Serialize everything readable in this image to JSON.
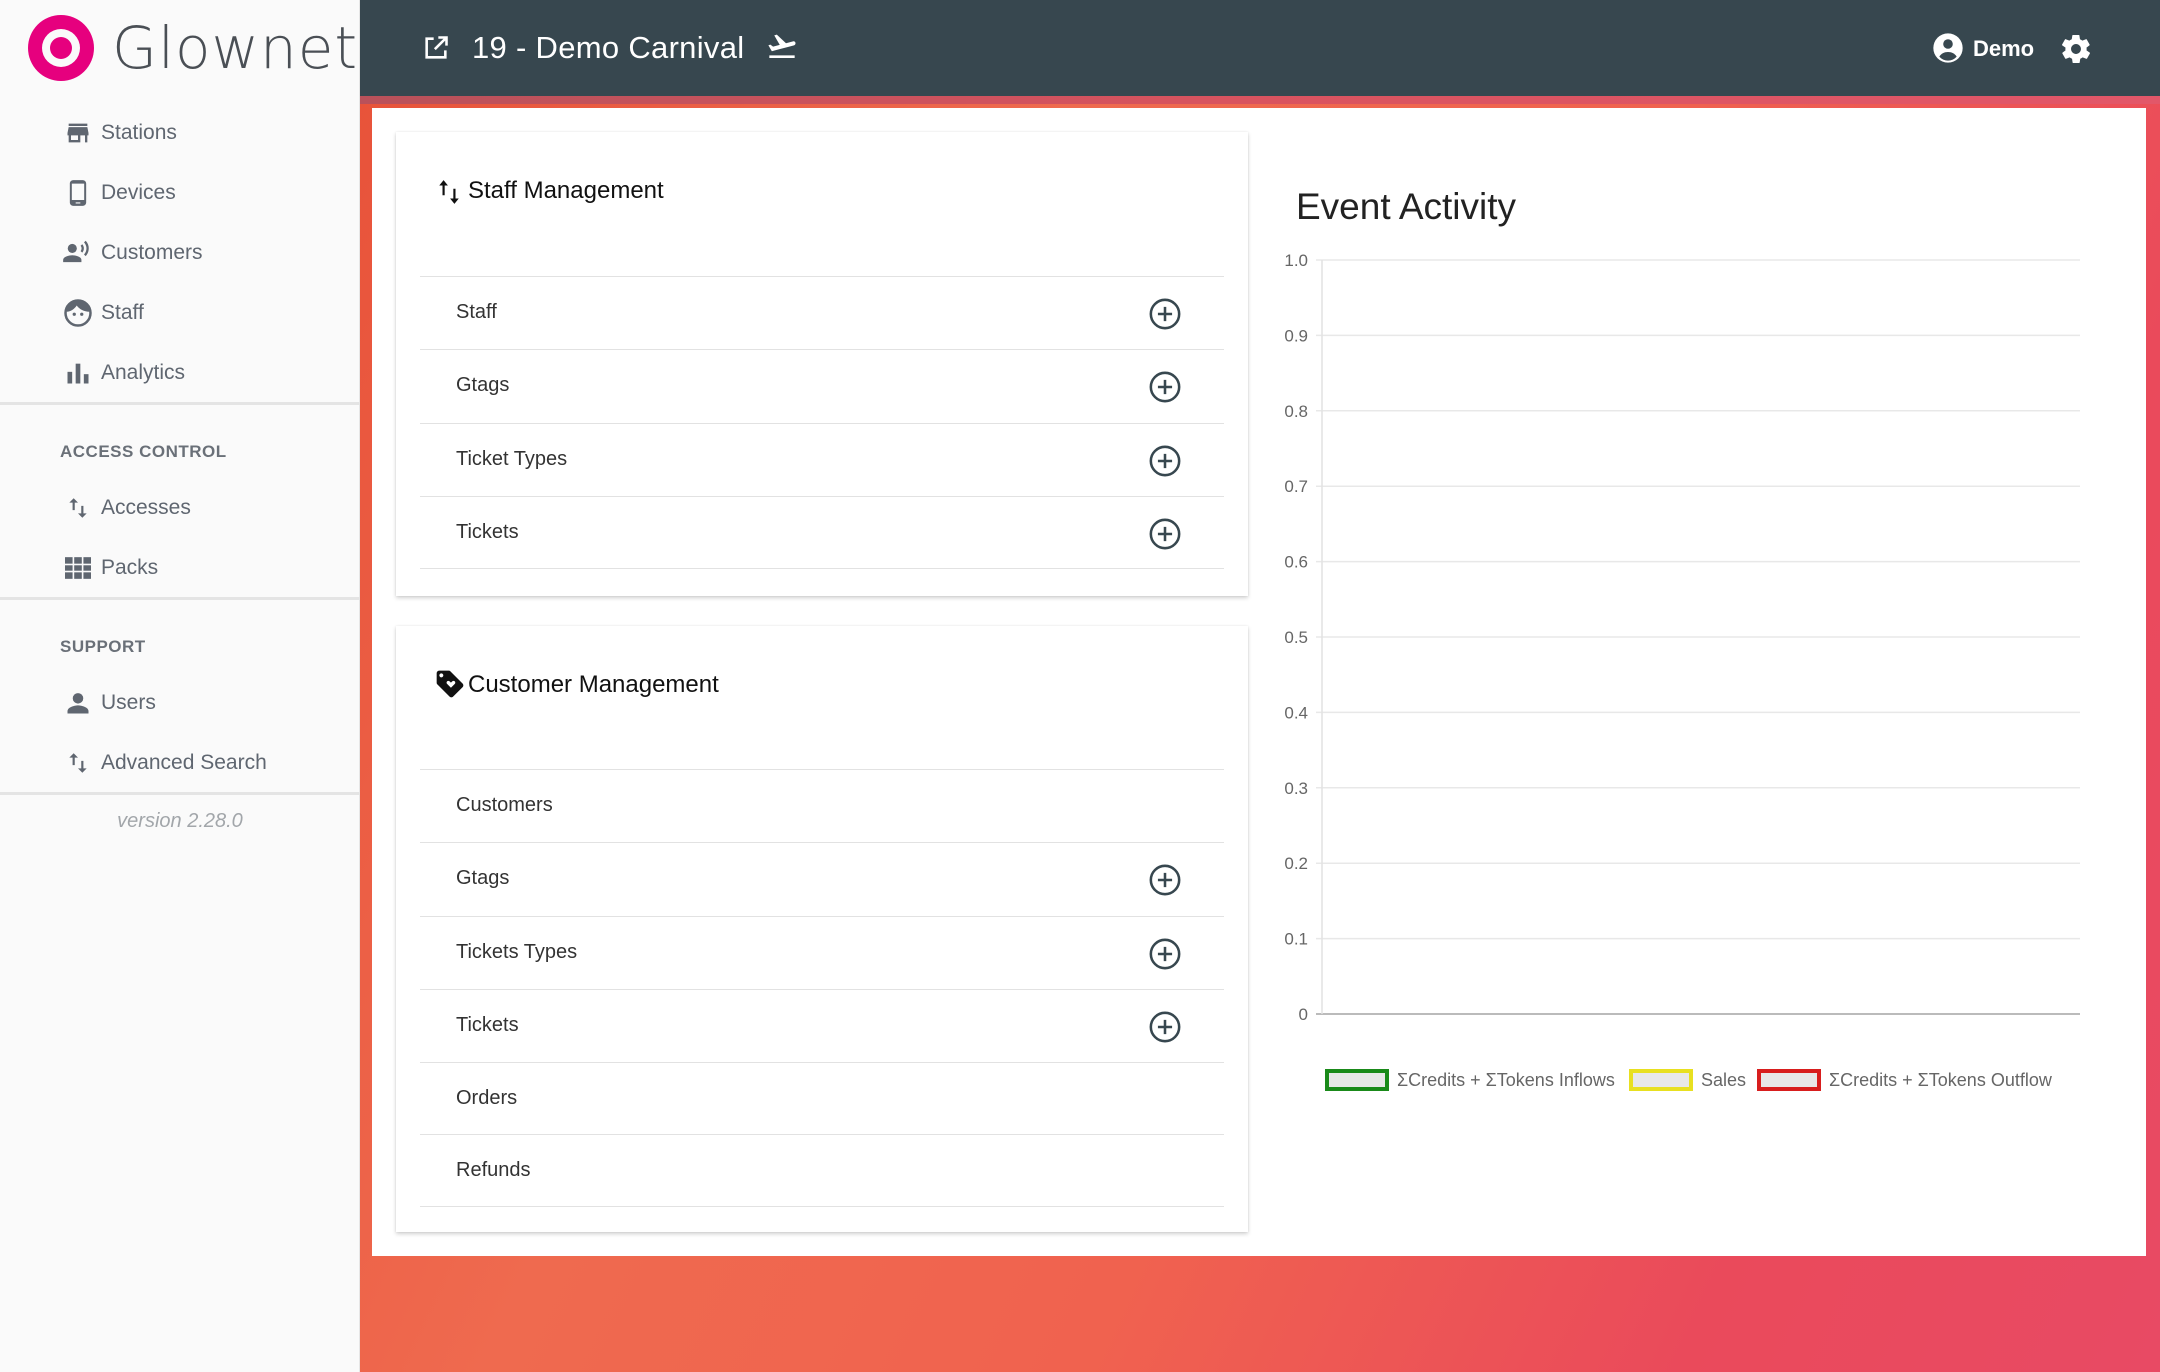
{
  "brand": {
    "name": "Glownet",
    "accent": "#e6007e"
  },
  "sidebar": {
    "items": [
      {
        "label": "Stations",
        "icon": "store-icon"
      },
      {
        "label": "Devices",
        "icon": "phone-icon"
      },
      {
        "label": "Customers",
        "icon": "customer-voice-icon"
      },
      {
        "label": "Staff",
        "icon": "face-icon"
      },
      {
        "label": "Analytics",
        "icon": "bar-chart-icon"
      }
    ],
    "access_control": {
      "heading": "ACCESS CONTROL",
      "items": [
        {
          "label": "Accesses",
          "icon": "swap-vertical-icon"
        },
        {
          "label": "Packs",
          "icon": "grid-icon"
        }
      ]
    },
    "support": {
      "heading": "SUPPORT",
      "items": [
        {
          "label": "Users",
          "icon": "person-icon"
        },
        {
          "label": "Advanced Search",
          "icon": "swap-vertical-icon"
        }
      ]
    },
    "version": "version 2.28.0"
  },
  "header": {
    "title": "19 - Demo Carnival",
    "user_label": "Demo",
    "bg_color": "#37474f"
  },
  "staff_management": {
    "title": "Staff Management",
    "rows": [
      {
        "label": "Staff",
        "addable": true
      },
      {
        "label": "Gtags",
        "addable": true
      },
      {
        "label": "Ticket Types",
        "addable": true
      },
      {
        "label": "Tickets",
        "addable": true
      }
    ]
  },
  "customer_management": {
    "title": "Customer Management",
    "rows": [
      {
        "label": "Customers",
        "addable": false
      },
      {
        "label": "Gtags",
        "addable": true
      },
      {
        "label": "Tickets Types",
        "addable": true
      },
      {
        "label": "Tickets",
        "addable": true
      },
      {
        "label": "Orders",
        "addable": false
      },
      {
        "label": "Refunds",
        "addable": false
      }
    ]
  },
  "chart_data": {
    "type": "line",
    "title": "Event Activity",
    "x": [],
    "ylim": [
      0,
      1.0
    ],
    "y_ticks": [
      "0",
      "0.1",
      "0.2",
      "0.3",
      "0.4",
      "0.5",
      "0.6",
      "0.7",
      "0.8",
      "0.9",
      "1.0"
    ],
    "grid": true,
    "legend_position": "bottom",
    "series": [
      {
        "name": "ΣCredits + ΣTokens Inflows",
        "color": "#1a8a1a",
        "values": []
      },
      {
        "name": "Sales",
        "color": "#e8e020",
        "values": []
      },
      {
        "name": "ΣCredits + ΣTokens Outflow",
        "color": "#d81e1e",
        "values": []
      }
    ]
  }
}
